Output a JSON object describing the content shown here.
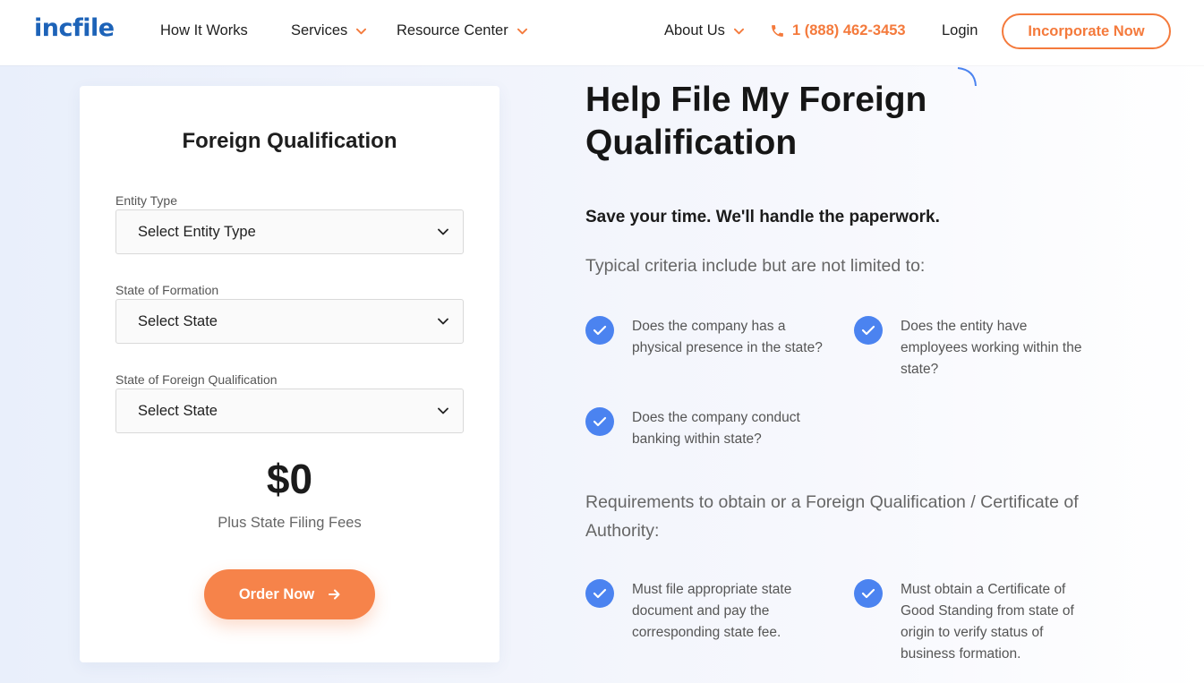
{
  "header": {
    "logo": "incfile",
    "nav": {
      "how_it_works": "How It Works",
      "services": "Services",
      "resource_center": "Resource Center",
      "about_us": "About Us"
    },
    "phone": "1 (888) 462-3453",
    "login": "Login",
    "cta": "Incorporate Now"
  },
  "form": {
    "title": "Foreign Qualification",
    "entity_type": {
      "label": "Entity Type",
      "value": "Select Entity Type"
    },
    "state_formation": {
      "label": "State of Formation",
      "value": "Select State"
    },
    "state_foreign": {
      "label": "State of Foreign Qualification",
      "value": "Select State"
    },
    "price": "$0",
    "price_note": "Plus State Filing Fees",
    "order_button": "Order Now"
  },
  "content": {
    "title": "Help File My Foreign Qualification",
    "lead": "Save your time. We'll handle the paperwork.",
    "criteria_heading": "Typical criteria include but are not limited to:",
    "criteria": [
      "Does the company has a physical presence in the state?",
      "Does the entity have employees working within the state?",
      "Does the company conduct banking within state?"
    ],
    "requirements_heading": "Requirements to obtain or a Foreign Qualification / Certificate of Authority:",
    "requirements": [
      "Must file appropriate state document and pay the corresponding state fee.",
      "Must obtain a Certificate of Good Standing from state of origin to verify status of business formation."
    ]
  },
  "colors": {
    "brand_blue": "#1d63b8",
    "accent_orange": "#f47a3c",
    "check_blue": "#4b83f0"
  },
  "icons": [
    "phone-icon",
    "chevron-down-icon",
    "check-icon",
    "arrow-right-icon"
  ]
}
